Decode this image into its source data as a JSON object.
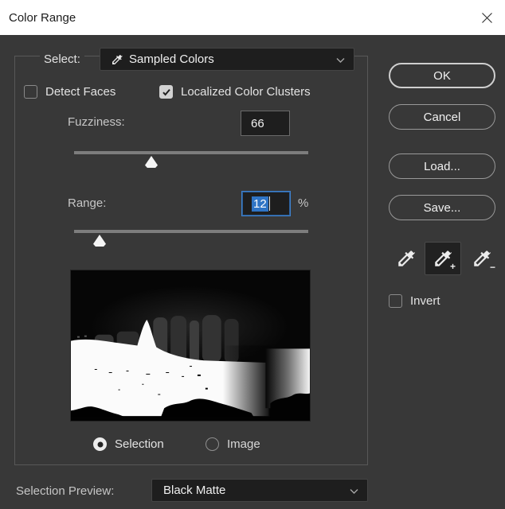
{
  "window": {
    "title": "Color Range"
  },
  "select_row": {
    "label": "Select:",
    "value": "Sampled Colors"
  },
  "options": {
    "detect_faces": {
      "label": "Detect Faces",
      "checked": false
    },
    "localized_clusters": {
      "label": "Localized Color Clusters",
      "checked": true
    }
  },
  "fuzziness": {
    "label": "Fuzziness:",
    "value": "66",
    "slider_percent": 33
  },
  "range": {
    "label": "Range:",
    "value": "12",
    "unit": "%",
    "slider_percent": 11
  },
  "preview": {
    "content": "black-and-white selection matte thumbnail",
    "radio_selection": "Selection",
    "radio_image": "Image",
    "selected_radio": "Selection"
  },
  "selection_preview": {
    "label": "Selection Preview:",
    "value": "Black Matte"
  },
  "actions": {
    "ok": "OK",
    "cancel": "Cancel",
    "load": "Load...",
    "save": "Save..."
  },
  "eyedroppers": {
    "sample": "eyedropper",
    "add": "eyedropper-plus",
    "subtract": "eyedropper-minus",
    "selected": "add",
    "plus_badge": "+",
    "minus_badge": "−"
  },
  "invert": {
    "label": "Invert",
    "checked": false
  },
  "colors": {
    "dialog_bg": "#383838",
    "titlebar_bg": "#ffffff",
    "field_bg": "#1e1e1e",
    "selection_blue": "#2f74c5",
    "focus_border": "#3f82cf",
    "slider_track": "#7d7d7d",
    "button_border": "#999999"
  }
}
